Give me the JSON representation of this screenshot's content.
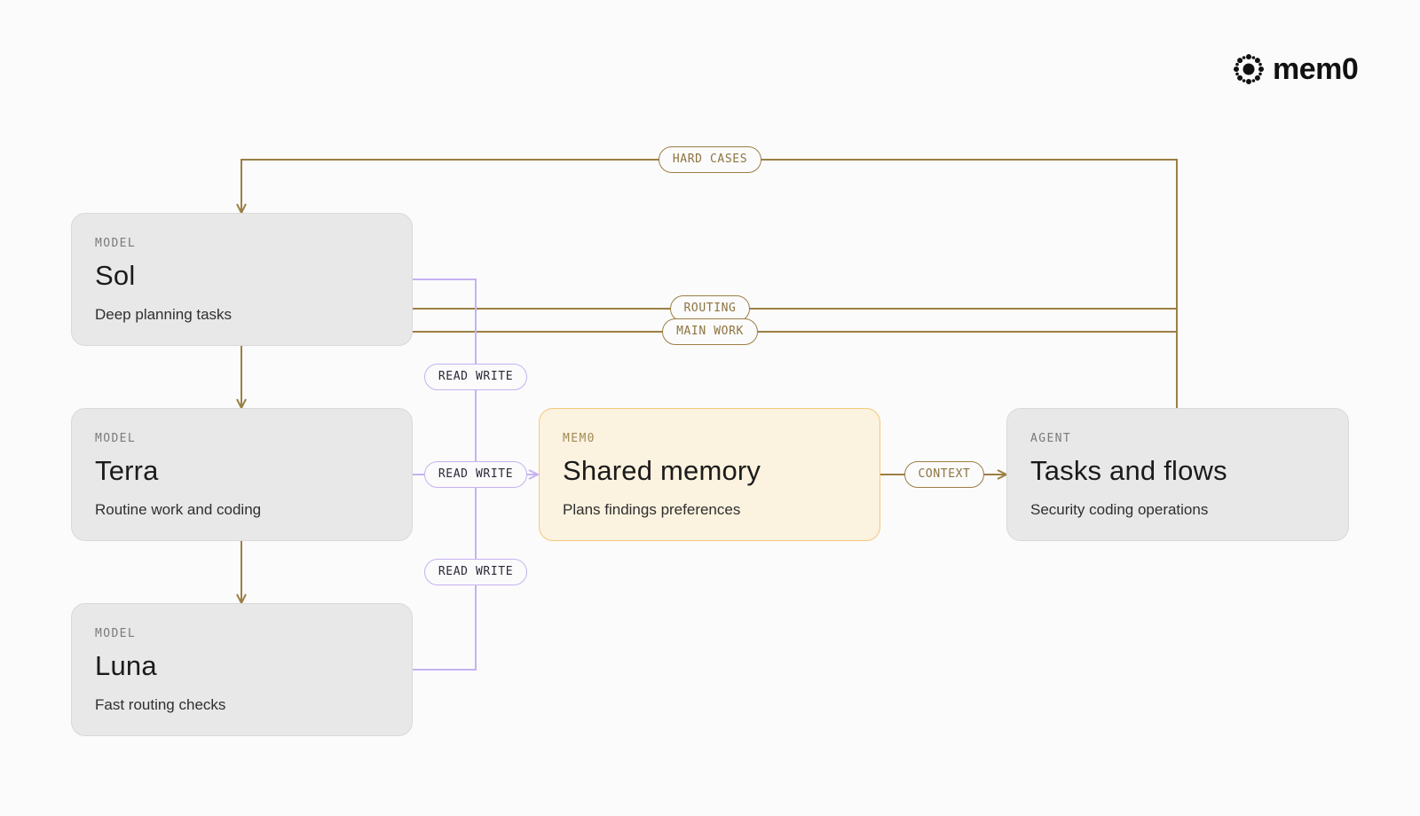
{
  "brand": {
    "wordmark": "mem0",
    "icon": "mem0-logo-icon"
  },
  "colors": {
    "flow": "#9b7f45",
    "memory_link": "#c5b2f2",
    "memory_fill": "#fbf2df",
    "node_fill": "#e8e8e8"
  },
  "nodes": {
    "sol": {
      "kicker": "MODEL",
      "title": "Sol",
      "desc": "Deep planning tasks"
    },
    "terra": {
      "kicker": "MODEL",
      "title": "Terra",
      "desc": "Routine work and coding"
    },
    "luna": {
      "kicker": "MODEL",
      "title": "Luna",
      "desc": "Fast routing checks"
    },
    "memory": {
      "kicker": "MEM0",
      "title": "Shared memory",
      "desc": "Plans findings preferences"
    },
    "agent": {
      "kicker": "AGENT",
      "title": "Tasks and flows",
      "desc": "Security coding operations"
    }
  },
  "edges": {
    "hard_cases": "HARD CASES",
    "routing": "ROUTING",
    "main_work": "MAIN WORK",
    "context": "CONTEXT",
    "read_write_sol": "READ WRITE",
    "read_write_terra": "READ WRITE",
    "read_write_luna": "READ WRITE"
  }
}
